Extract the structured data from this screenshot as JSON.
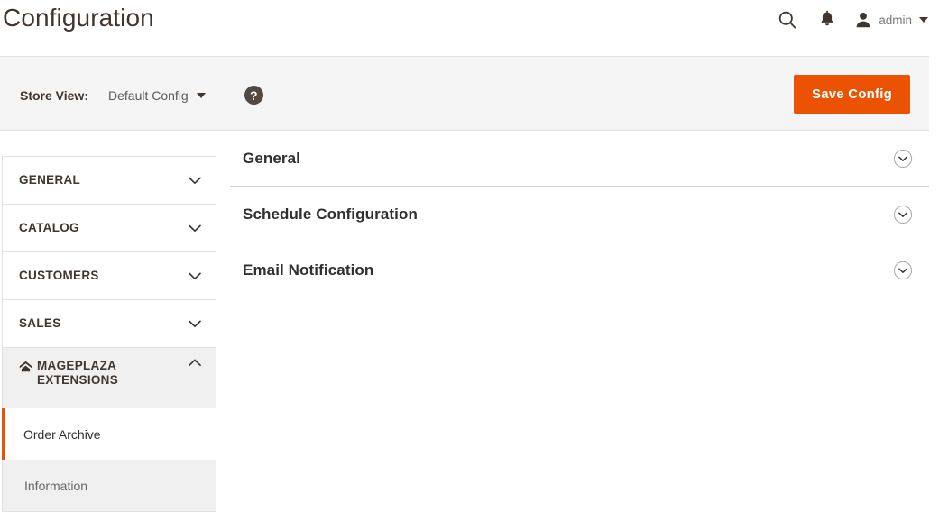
{
  "header": {
    "title": "Configuration",
    "search_icon": "search-icon",
    "notifications_icon": "bell-icon",
    "avatar_icon": "user-avatar-icon",
    "user_name": "admin",
    "caret_icon": "caret-down-icon"
  },
  "storeview": {
    "label": "Store View:",
    "selected": "Default Config",
    "caret_icon": "caret-down-icon",
    "help_icon": "question-mark-icon",
    "help_glyph": "?",
    "save_label": "Save Config"
  },
  "colors": {
    "accent_orange": "#eb5202",
    "bar_background": "#f5f5f5",
    "nav_group_background": "#f0f0f0",
    "text_dark": "#41362f",
    "help_circle": "#514943",
    "border": "#e3e3e3"
  },
  "sidebar": {
    "sections": [
      {
        "label": "GENERAL",
        "icon": "chevron-down-icon",
        "expanded": false
      },
      {
        "label": "CATALOG",
        "icon": "chevron-down-icon",
        "expanded": false
      },
      {
        "label": "CUSTOMERS",
        "icon": "chevron-down-icon",
        "expanded": false
      },
      {
        "label": "SALES",
        "icon": "chevron-down-icon",
        "expanded": false
      }
    ],
    "group": {
      "label": "MAGEPLAZA EXTENSIONS",
      "brand_icon": "mageplaza-roof-icon",
      "icon": "chevron-up-icon",
      "expanded": true,
      "items": [
        {
          "label": "Order Archive",
          "active": true
        },
        {
          "label": "Information",
          "active": false
        }
      ]
    }
  },
  "main": {
    "fieldsets": [
      {
        "title": "General",
        "icon": "chevron-down-circle-icon",
        "expanded": false
      },
      {
        "title": "Schedule Configuration",
        "icon": "chevron-down-circle-icon",
        "expanded": false
      },
      {
        "title": "Email Notification",
        "icon": "chevron-down-circle-icon",
        "expanded": false
      }
    ]
  }
}
